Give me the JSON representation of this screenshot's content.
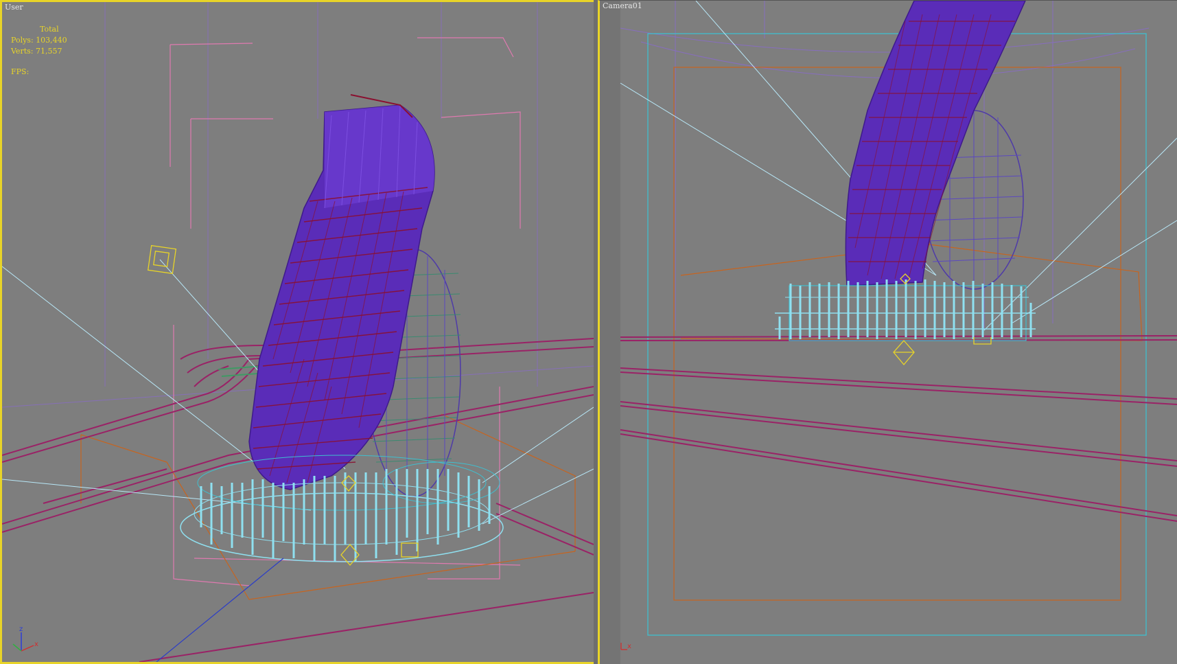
{
  "viewports": {
    "user": {
      "label": "User",
      "stats": {
        "total_label": "Total",
        "polys_label": "Polys:",
        "polys_value": "103,440",
        "verts_label": "Verts:",
        "verts_value": "71,557",
        "fps_label": "FPS:"
      },
      "axes": {
        "z": "z",
        "x": "x"
      }
    },
    "camera": {
      "label": "Camera01",
      "axes": {
        "x": "x"
      }
    }
  },
  "colors": {
    "active_border": "#e8d428",
    "background": "#7e7e7e",
    "tower_primary": "#5a2cb8",
    "tower_edge": "#8a1030",
    "tower_secondary": "#4e3aa8",
    "base_cyan": "#8fe0f0",
    "road": "#9a2266",
    "light_pink": "#e07ab0",
    "orange_frame": "#c8641e",
    "safe_frame": "#3fbfcf",
    "camera_line": "#b8e8f8"
  }
}
